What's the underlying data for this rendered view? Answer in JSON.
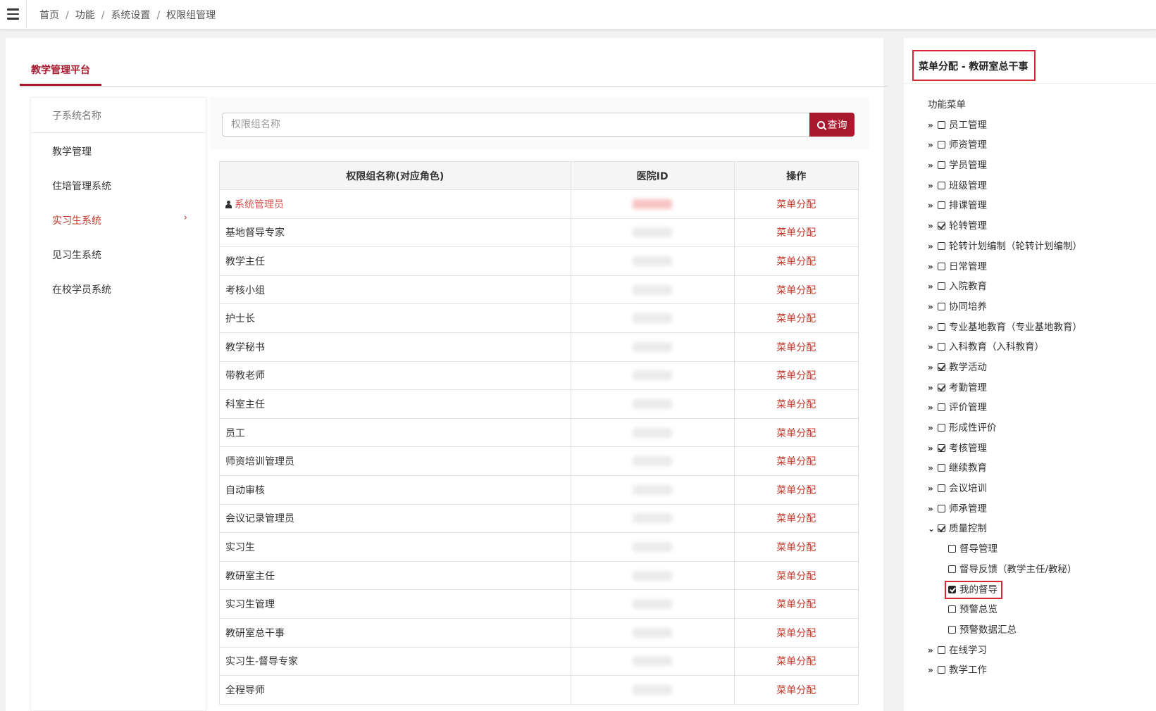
{
  "breadcrumb": [
    "首页",
    "功能",
    "系统设置",
    "权限组管理"
  ],
  "platform_tab": "教学管理平台",
  "sidebar": {
    "header": "子系统名称",
    "items": [
      {
        "label": "教学管理",
        "active": false
      },
      {
        "label": "住培管理系统",
        "active": false
      },
      {
        "label": "实习生系统",
        "active": true
      },
      {
        "label": "见习生系统",
        "active": false
      },
      {
        "label": "在校学员系统",
        "active": false
      }
    ]
  },
  "search": {
    "placeholder": "权限组名称",
    "button_label": "查询"
  },
  "table": {
    "columns": [
      "权限组名称(对应角色)",
      "医院ID",
      "操作"
    ],
    "rows": [
      {
        "name": "系统管理员",
        "op": "菜单分配"
      },
      {
        "name": "基地督导专家",
        "op": "菜单分配"
      },
      {
        "name": "教学主任",
        "op": "菜单分配"
      },
      {
        "name": "考核小组",
        "op": "菜单分配"
      },
      {
        "name": "护士长",
        "op": "菜单分配"
      },
      {
        "name": "教学秘书",
        "op": "菜单分配"
      },
      {
        "name": "带教老师",
        "op": "菜单分配"
      },
      {
        "name": "科室主任",
        "op": "菜单分配"
      },
      {
        "name": "员工",
        "op": "菜单分配"
      },
      {
        "name": "师资培训管理员",
        "op": "菜单分配"
      },
      {
        "name": "自动审核",
        "op": "菜单分配"
      },
      {
        "name": "会议记录管理员",
        "op": "菜单分配"
      },
      {
        "name": "实习生",
        "op": "菜单分配"
      },
      {
        "name": "教研室主任",
        "op": "菜单分配"
      },
      {
        "name": "实习生管理",
        "op": "菜单分配"
      },
      {
        "name": "教研室总干事",
        "op": "菜单分配"
      },
      {
        "name": "实习生-督导专家",
        "op": "菜单分配"
      },
      {
        "name": "全程导师",
        "op": "菜单分配"
      }
    ]
  },
  "right_panel": {
    "title": "菜单分配 - 教研室总干事",
    "root": "功能菜单",
    "nodes": [
      {
        "label": "员工管理",
        "checked": false,
        "level": 1,
        "expanded": false
      },
      {
        "label": "师资管理",
        "checked": false,
        "level": 1,
        "expanded": false
      },
      {
        "label": "学员管理",
        "checked": false,
        "level": 1,
        "expanded": false
      },
      {
        "label": "班级管理",
        "checked": false,
        "level": 1,
        "expanded": false
      },
      {
        "label": "排课管理",
        "checked": false,
        "level": 1,
        "expanded": false
      },
      {
        "label": "轮转管理",
        "checked": true,
        "level": 1,
        "expanded": false
      },
      {
        "label": "轮转计划编制（轮转计划编制）",
        "checked": false,
        "level": 1,
        "expanded": false
      },
      {
        "label": "日常管理",
        "checked": false,
        "level": 1,
        "expanded": false
      },
      {
        "label": "入院教育",
        "checked": false,
        "level": 1,
        "expanded": false
      },
      {
        "label": "协同培养",
        "checked": false,
        "level": 1,
        "expanded": false
      },
      {
        "label": "专业基地教育（专业基地教育）",
        "checked": false,
        "level": 1,
        "expanded": false
      },
      {
        "label": "入科教育（入科教育）",
        "checked": false,
        "level": 1,
        "expanded": false
      },
      {
        "label": "教学活动",
        "checked": true,
        "level": 1,
        "expanded": false
      },
      {
        "label": "考勤管理",
        "checked": true,
        "level": 1,
        "expanded": false
      },
      {
        "label": "评价管理",
        "checked": false,
        "level": 1,
        "expanded": false
      },
      {
        "label": "形成性评价",
        "checked": false,
        "level": 1,
        "expanded": false
      },
      {
        "label": "考核管理",
        "checked": true,
        "level": 1,
        "expanded": false
      },
      {
        "label": "继续教育",
        "checked": false,
        "level": 1,
        "expanded": false
      },
      {
        "label": "会议培训",
        "checked": false,
        "level": 1,
        "expanded": false
      },
      {
        "label": "师承管理",
        "checked": false,
        "level": 1,
        "expanded": false
      },
      {
        "label": "质量控制",
        "checked": true,
        "level": 1,
        "expanded": true
      },
      {
        "label": "督导管理",
        "checked": false,
        "level": 2
      },
      {
        "label": "督导反馈（教学主任/教秘）",
        "checked": false,
        "level": 2
      },
      {
        "label": "我的督导",
        "checked": true,
        "level": 2,
        "highlight": true
      },
      {
        "label": "预警总览",
        "checked": false,
        "level": 2
      },
      {
        "label": "预警数据汇总",
        "checked": false,
        "level": 2
      },
      {
        "label": "在线学习",
        "checked": false,
        "level": 1,
        "expanded": false
      },
      {
        "label": "教学工作",
        "checked": false,
        "level": 1,
        "expanded": false
      }
    ]
  },
  "colors": {
    "accent": "#a8192e",
    "link": "#c0392b",
    "highlight_border": "#d9273a"
  }
}
